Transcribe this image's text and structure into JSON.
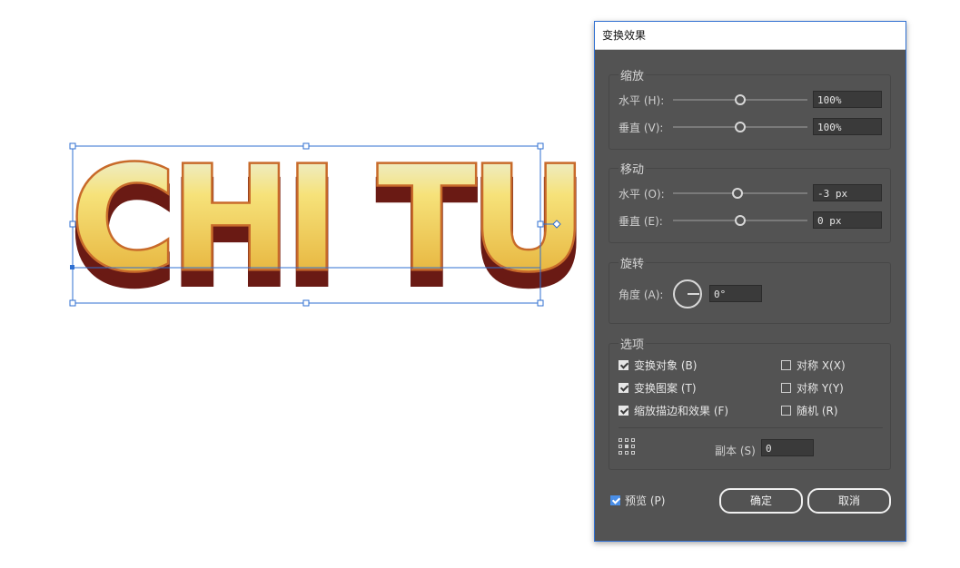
{
  "canvas": {
    "artwork_text": "CHI TU",
    "colors": {
      "fill_top": "#e8f4fb",
      "fill_mid": "#f6e27a",
      "fill_bottom": "#e2a62a",
      "outline": "#c86a2a",
      "extrude": "#6a1a14",
      "selection": "#2f6fd1"
    }
  },
  "dialog": {
    "title": "变换效果",
    "scale": {
      "label": "缩放",
      "horizontal": {
        "label": "水平 (H):",
        "value": "100%",
        "level": 0.5
      },
      "vertical": {
        "label": "垂直 (V):",
        "value": "100%",
        "level": 0.5
      }
    },
    "move": {
      "label": "移动",
      "horizontal": {
        "label": "水平 (O):",
        "value": "-3 px",
        "level": 0.48
      },
      "vertical": {
        "label": "垂直 (E):",
        "value": "0 px",
        "level": 0.5
      }
    },
    "rotate": {
      "label": "旋转",
      "angle_label": "角度 (A):",
      "angle_value": "0°"
    },
    "options": {
      "label": "选项",
      "transform_objects": {
        "label": "变换对象 (B)",
        "checked": true
      },
      "transform_patterns": {
        "label": "变换图案 (T)",
        "checked": true
      },
      "scale_strokes": {
        "label": "缩放描边和效果 (F)",
        "checked": true
      },
      "reflect_x": {
        "label": "对称 X(X)",
        "checked": false
      },
      "reflect_y": {
        "label": "对称 Y(Y)",
        "checked": false
      },
      "random": {
        "label": "随机 (R)",
        "checked": false
      },
      "copies_label": "副本 (S)",
      "copies_value": "0"
    },
    "preview": {
      "label": "预览 (P)",
      "checked": true
    },
    "ok_label": "确定",
    "cancel_label": "取消"
  }
}
